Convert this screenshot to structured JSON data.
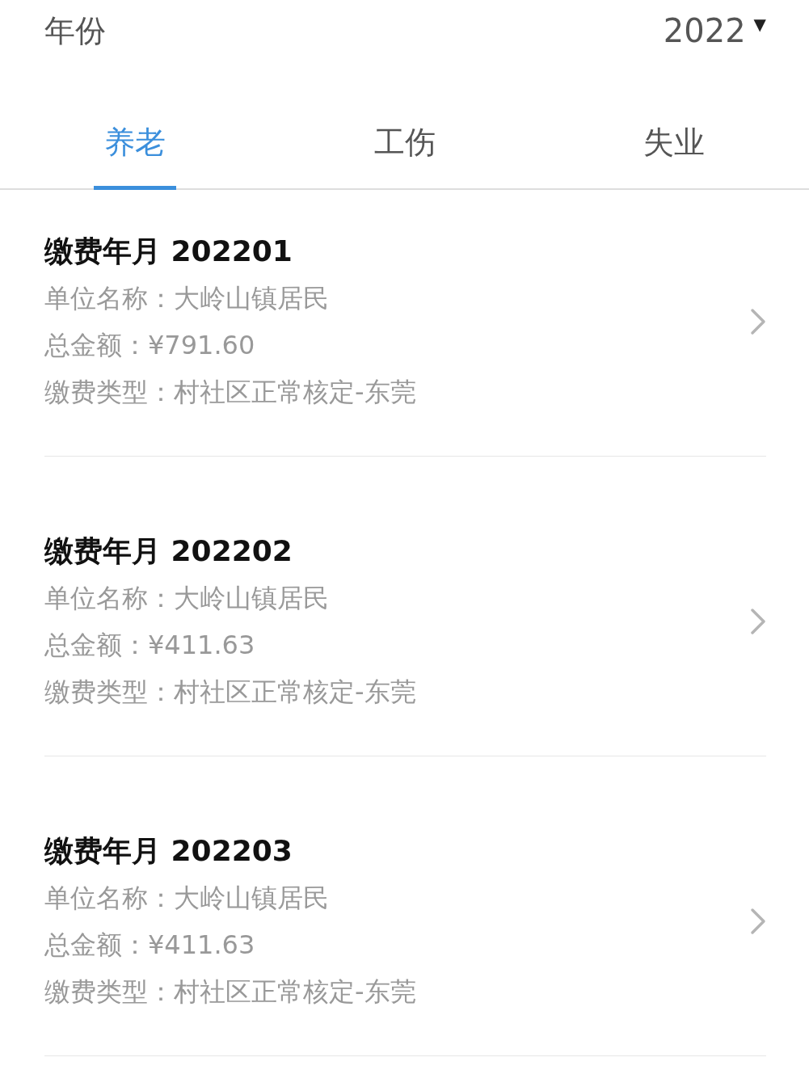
{
  "year_filter": {
    "label": "年份",
    "value": "2022",
    "caret": "▼"
  },
  "tabs": [
    {
      "label": "养老",
      "selected": true
    },
    {
      "label": "工伤",
      "selected": false
    },
    {
      "label": "失业",
      "selected": false
    }
  ],
  "records": [
    {
      "title": "缴费年月 202201",
      "fields": [
        {
          "label": "单位名称：",
          "value": "大岭山镇居民"
        },
        {
          "label": "总金额：",
          "value": "¥791.60"
        },
        {
          "label": "缴费类型：",
          "value": "村社区正常核定-东莞"
        }
      ]
    },
    {
      "title": "缴费年月 202202",
      "fields": [
        {
          "label": "单位名称：",
          "value": "大岭山镇居民"
        },
        {
          "label": "总金额：",
          "value": "¥411.63"
        },
        {
          "label": "缴费类型：",
          "value": "村社区正常核定-东莞"
        }
      ]
    },
    {
      "title": "缴费年月 202203",
      "fields": [
        {
          "label": "单位名称：",
          "value": "大岭山镇居民"
        },
        {
          "label": "总金额：",
          "value": "¥411.63"
        },
        {
          "label": "缴费类型：",
          "value": "村社区正常核定-东莞"
        }
      ]
    }
  ]
}
